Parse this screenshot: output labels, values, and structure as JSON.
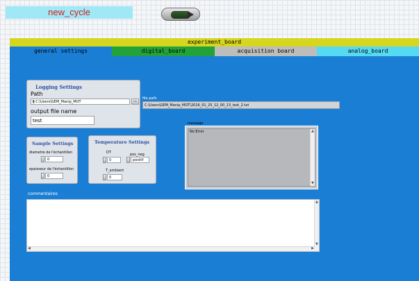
{
  "header": {
    "title": "new_cycle"
  },
  "board": {
    "title": "experiment_board",
    "tabs": [
      "general settings",
      "digital_board",
      "acquisition board",
      "analog_board"
    ]
  },
  "logging": {
    "title": "Logging Settings",
    "path_label": "Path",
    "path_value": "C:\\Users\\GEM_Manip_MOT",
    "output_label": "output file name",
    "output_value": "test"
  },
  "file_path": {
    "label": "file path",
    "value": "C:\\Users\\GEM_Manip_MOT\\2016_01_25_12_00_13_test_2.txt"
  },
  "message": {
    "label": "message",
    "value": "No Error"
  },
  "sample": {
    "title": "Sample Settings",
    "diametre_label": "diametre de l'échantillon",
    "diametre_value": "0",
    "epaisseur_label": "epaisseur de l'échantillon",
    "epaisseur_value": "0"
  },
  "temperature": {
    "title": "Temperature Settings",
    "dt_label": "DT",
    "dt_value": "0",
    "pos_neg_label": "pos_neg",
    "pos_neg_value": "positif",
    "t_ambiant_label": "T_ambiant",
    "t_ambiant_value": "0"
  },
  "comments": {
    "label": "commentaires",
    "value": ""
  },
  "colors": {
    "panel_blue": "#1a7fd4",
    "header_yellow": "#d6d61f",
    "digital_green": "#24a23a",
    "acquisition_gray": "#bdbdbd",
    "analog_cyan": "#56d9f2",
    "title_red": "#d81b1b"
  }
}
